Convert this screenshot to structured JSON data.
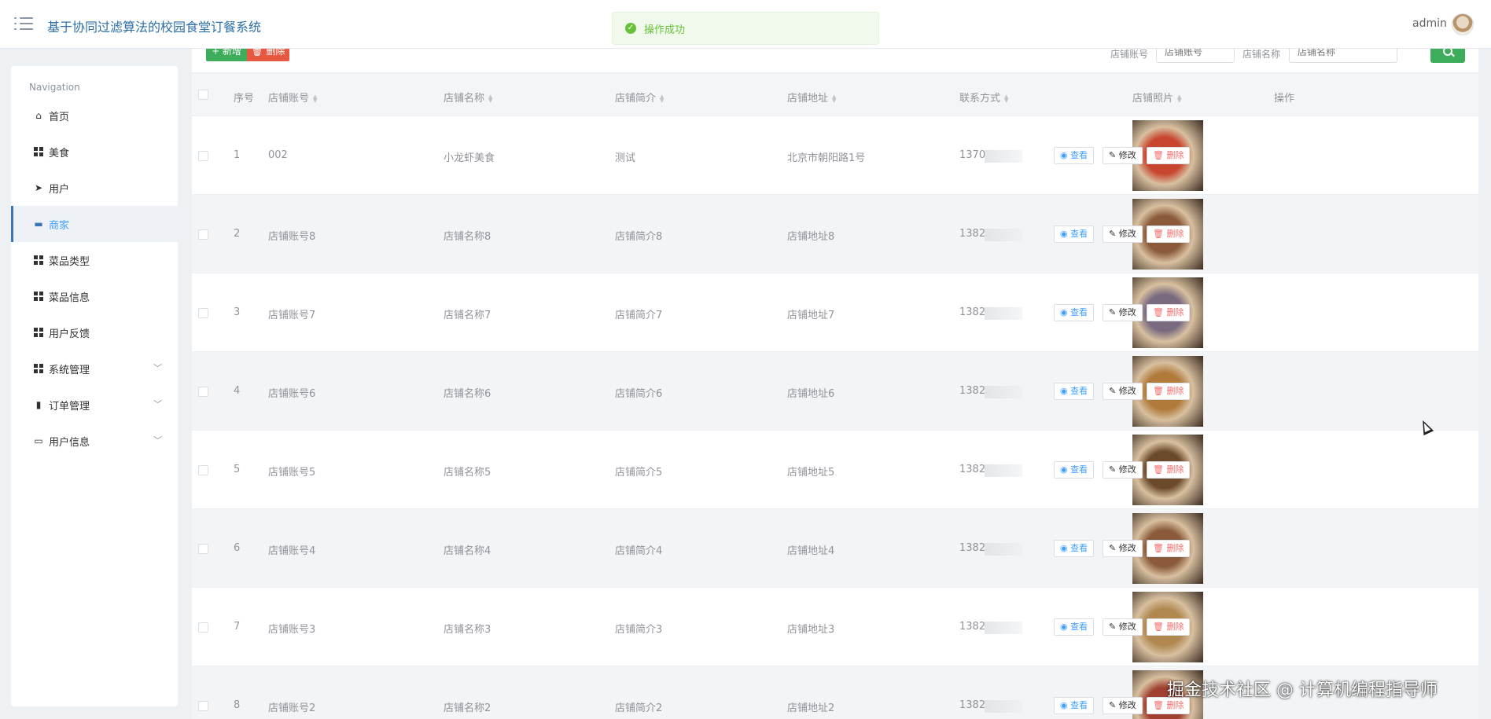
{
  "header": {
    "app_title": "基于协同过滤算法的校园食堂订餐系统",
    "user_name": "admin",
    "toast": "操作成功"
  },
  "sidebar": {
    "heading": "Navigation",
    "items": [
      {
        "label": "首页",
        "icon": "home-icon"
      },
      {
        "label": "美食",
        "icon": "grid-icon"
      },
      {
        "label": "用户",
        "icon": "send-icon"
      },
      {
        "label": "商家",
        "icon": "monitor-icon",
        "active": true
      },
      {
        "label": "菜品类型",
        "icon": "grid-icon"
      },
      {
        "label": "菜品信息",
        "icon": "grid-icon"
      },
      {
        "label": "用户反馈",
        "icon": "grid-icon"
      },
      {
        "label": "系统管理",
        "icon": "grid-icon",
        "expandable": true
      },
      {
        "label": "订单管理",
        "icon": "bar-chart-icon",
        "expandable": true
      },
      {
        "label": "用户信息",
        "icon": "card-icon",
        "expandable": true
      }
    ]
  },
  "toolbar": {
    "add_label": "+ 新增",
    "batch_delete_label": "🗑 删除",
    "search_account_label": "店铺账号",
    "search_account_placeholder": "店铺账号",
    "search_name_label": "店铺名称",
    "search_name_placeholder": "店铺名称"
  },
  "table": {
    "columns": [
      "序号",
      "店铺账号",
      "店铺名称",
      "店铺简介",
      "店铺地址",
      "联系方式",
      "店铺照片",
      "操作"
    ],
    "actions": {
      "view": "查看",
      "edit": "修改",
      "delete": "删除"
    },
    "rows": [
      {
        "index": "1",
        "account": "002",
        "name": "小龙虾美食",
        "intro": "测试",
        "address": "北京市朝阳路1号",
        "phone": "1370",
        "photo_color": "#c8452f"
      },
      {
        "index": "2",
        "account": "店铺账号8",
        "name": "店铺名称8",
        "intro": "店铺简介8",
        "address": "店铺地址8",
        "phone": "1382",
        "photo_color": "#8a5a3a"
      },
      {
        "index": "3",
        "account": "店铺账号7",
        "name": "店铺名称7",
        "intro": "店铺简介7",
        "address": "店铺地址7",
        "phone": "1382",
        "photo_color": "#7a6a80"
      },
      {
        "index": "4",
        "account": "店铺账号6",
        "name": "店铺名称6",
        "intro": "店铺简介6",
        "address": "店铺地址6",
        "phone": "1382",
        "photo_color": "#b07a3a"
      },
      {
        "index": "5",
        "account": "店铺账号5",
        "name": "店铺名称5",
        "intro": "店铺简介5",
        "address": "店铺地址5",
        "phone": "1382",
        "photo_color": "#6a4a2a"
      },
      {
        "index": "6",
        "account": "店铺账号4",
        "name": "店铺名称4",
        "intro": "店铺简介4",
        "address": "店铺地址4",
        "phone": "1382",
        "photo_color": "#8a5a3a"
      },
      {
        "index": "7",
        "account": "店铺账号3",
        "name": "店铺名称3",
        "intro": "店铺简介3",
        "address": "店铺地址3",
        "phone": "1382",
        "photo_color": "#b08850"
      },
      {
        "index": "8",
        "account": "店铺账号2",
        "name": "店铺名称2",
        "intro": "店铺简介2",
        "address": "店铺地址2",
        "phone": "1382",
        "photo_color": "#a04030"
      }
    ]
  },
  "watermark": "掘金技术社区 @ 计算机编程指导师"
}
